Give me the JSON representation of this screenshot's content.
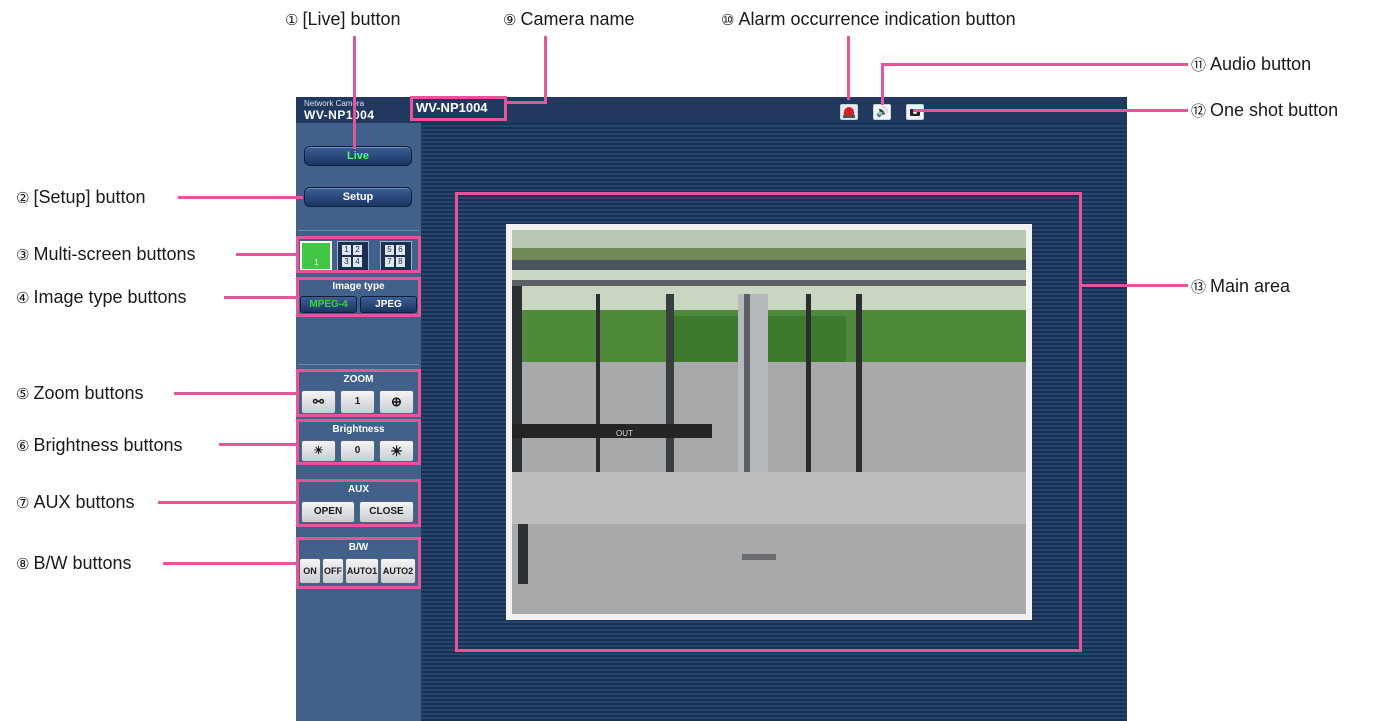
{
  "callouts": {
    "live": {
      "num": "①",
      "text": "[Live] button"
    },
    "setup": {
      "num": "②",
      "text": "[Setup] button"
    },
    "multi": {
      "num": "③",
      "text": "Multi-screen buttons"
    },
    "imgtype": {
      "num": "④",
      "text": "Image type buttons"
    },
    "zoom": {
      "num": "⑤",
      "text": "Zoom buttons"
    },
    "bright": {
      "num": "⑥",
      "text": "Brightness buttons"
    },
    "aux": {
      "num": "⑦",
      "text": "AUX buttons"
    },
    "bw": {
      "num": "⑧",
      "text": "B/W buttons"
    },
    "camname": {
      "num": "⑨",
      "text": "Camera name"
    },
    "alarm": {
      "num": "⑩",
      "text": "Alarm occurrence indication button"
    },
    "audio": {
      "num": "⑪",
      "text": "Audio button"
    },
    "oneshot": {
      "num": "⑫",
      "text": "One shot button"
    },
    "mainarea": {
      "num": "⑬",
      "text": "Main area"
    }
  },
  "ui": {
    "brand_small": "Network Camera",
    "brand_model": "WV-NP1004",
    "camera_name": "WV-NP1004",
    "live_label": "Live",
    "setup_label": "Setup",
    "multi": {
      "single": "1",
      "quad_a": [
        "1",
        "2",
        "3",
        "4"
      ],
      "quad_b": [
        "5",
        "6",
        "7",
        "8"
      ]
    },
    "image_type": {
      "title": "Image type",
      "mpeg4": "MPEG-4",
      "jpeg": "JPEG"
    },
    "zoom": {
      "title": "ZOOM",
      "value": "1"
    },
    "brightness": {
      "title": "Brightness",
      "value": "0"
    },
    "aux": {
      "title": "AUX",
      "open": "OPEN",
      "close": "CLOSE"
    },
    "bw": {
      "title": "B/W",
      "on": "ON",
      "off": "OFF",
      "auto1": "AUTO1",
      "auto2": "AUTO2"
    },
    "door_sign": "OUT"
  },
  "colors": {
    "callout_line": "#e6559a",
    "live_text": "#4cff6a",
    "mpeg4_text": "#37d23c"
  }
}
